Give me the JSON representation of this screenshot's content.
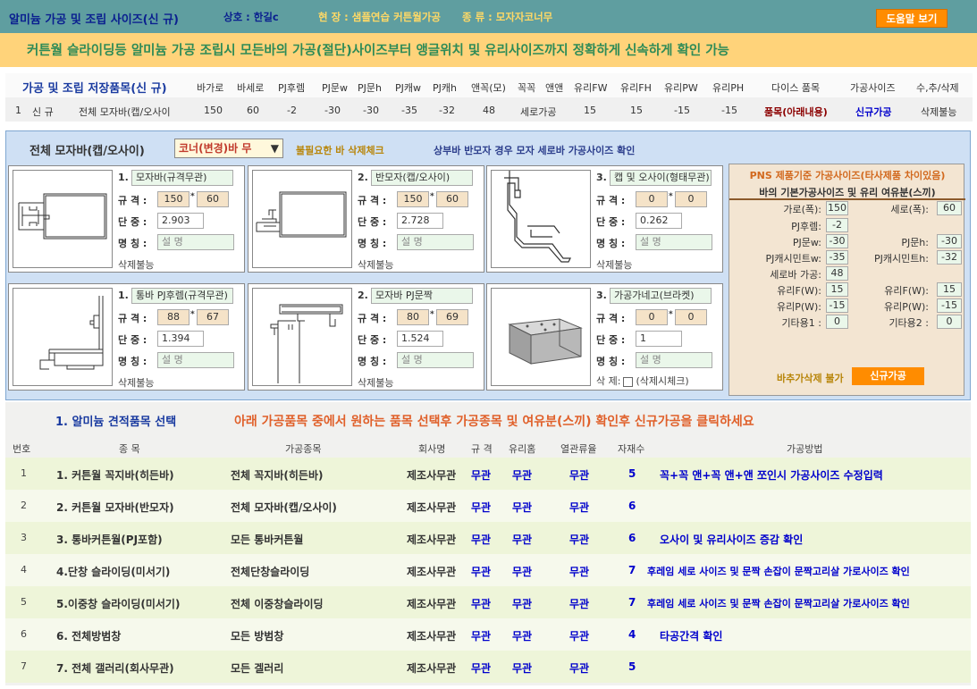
{
  "header": {
    "title": "알미늄 가공 및 조립 사이즈(신 규)",
    "company": "상호 : 한길c",
    "site": "현 장 : 샘플연습 커튼월가공",
    "kind": "종 류 : 모자자코너무",
    "help": "도움말 보기"
  },
  "banner": "커튼월 슬라이딩등 알미늄 가공 조립시 모든바의 가공(절단)사이즈부터 앵글위치 및 유리사이즈까지 정확하게 신속하게 확인 가능",
  "saved": {
    "title": "가공 및 조립 저장품목(신 규)",
    "headers": [
      "바가로",
      "바세로",
      "PJ후렘",
      "PJ문w",
      "PJ문h",
      "PJ캐w",
      "PJ캐h",
      "앤꼭(모)",
      "꼭꼭",
      "앤앤",
      "유리FW",
      "유리FH",
      "유리PW",
      "유리PH",
      "다이스 품목",
      "가공사이즈",
      "수,추/삭제"
    ],
    "row": {
      "no": "1",
      "type": "신 규",
      "name": "전체 모자바(캡/오사이",
      "vals": [
        "150",
        "60",
        "-2",
        "-30",
        "-30",
        "-35",
        "-32",
        "48",
        "세로가공",
        "15",
        "15",
        "-15",
        "-15"
      ],
      "dice": "품목(아래내용)",
      "size": "신규가공",
      "del": "삭제불능"
    }
  },
  "panel": {
    "title": "전체 모자바(캡/오사이)",
    "select": "코너(변경)바 무",
    "note1": "불필요한 바 삭제체크",
    "note2": "상부바 반모자 경우 모자 세로바 가공사이즈 확인",
    "labels": {
      "spec": "규 격 :",
      "weight": "단 중 :",
      "name": "명 칭 :",
      "x": "*",
      "desc": "설 명",
      "nodel": "삭제불능",
      "delcheck": "삭 제:",
      "delcheck2": "(삭제시체크)"
    },
    "cards": [
      {
        "n": "1.",
        "name": "모자바(규격무관)",
        "w": "150",
        "h": "60",
        "weight": "2.903"
      },
      {
        "n": "2.",
        "name": "반모자(캡/오사이)",
        "w": "150",
        "h": "60",
        "weight": "2.728"
      },
      {
        "n": "3.",
        "name": "캡 및 오사이(형태무관)",
        "w": "0",
        "h": "0",
        "weight": "0.262"
      },
      {
        "n": "1.",
        "name": "통바 PJ후렘(규격무관)",
        "w": "88",
        "h": "67",
        "weight": "1.394"
      },
      {
        "n": "2.",
        "name": "모자바 PJ문짝",
        "w": "80",
        "h": "69",
        "weight": "1.524"
      },
      {
        "n": "3.",
        "name": "가공가네고(브라켓)",
        "w": "0",
        "h": "0",
        "weight": "1"
      }
    ]
  },
  "pns": {
    "h1": "PNS 제품기준 가공사이즈(타사제품 차이있음)",
    "h2": "바의 기본가공사이즈 및 유리 여유분(스끼)",
    "left": [
      [
        "가로(폭):",
        "150"
      ],
      [
        "PJ후렘:",
        "-2"
      ],
      [
        "PJ문w:",
        "-30"
      ],
      [
        "PJ캐시민트w:",
        "-35"
      ],
      [
        "세로바 가공:",
        "48"
      ],
      [
        "유리F(W):",
        "15"
      ],
      [
        "유리P(W):",
        "-15"
      ],
      [
        "기타용1 :",
        "0"
      ]
    ],
    "right": [
      [
        "세로(폭):",
        "60"
      ],
      [
        "PJ문h:",
        "-30"
      ],
      [
        "PJ캐시민트h:",
        "-32"
      ],
      [
        "유리F(W):",
        "15"
      ],
      [
        "유리P(W):",
        "-15"
      ],
      [
        "기타용2 :",
        "0"
      ]
    ],
    "nodel": "바추가삭제 불가",
    "newbtn": "신규가공"
  },
  "selection": {
    "title": "1. 알미늄 견적품목 선택",
    "msg": "아래 가공품목 중에서 원하는 품목 선택후 가공종목 및 여유분(스끼) 확인후 신규가공을 클릭하세요",
    "headers": [
      "번호",
      "종 목",
      "가공종목",
      "회사명",
      "규 격",
      "유리홈",
      "열관류율",
      "자재수",
      "가공방법"
    ],
    "rows": [
      {
        "no": "1",
        "item": "1. 커튼월 꼭지바(히든바)",
        "proc": "전체 꼭지바(히든바)",
        "co": "제조사무관",
        "spec": "무관",
        "groove": "무관",
        "heat": "무관",
        "cnt": "5",
        "method": "꼭+꼭 앤+꼭 앤+앤 쪼인시 가공사이즈 수정입력"
      },
      {
        "no": "2",
        "item": "2. 커튼월 모자바(반모자)",
        "proc": "전체 모자바(캡/오사이)",
        "co": "제조사무관",
        "spec": "무관",
        "groove": "무관",
        "heat": "무관",
        "cnt": "6",
        "method": ""
      },
      {
        "no": "3",
        "item": "3. 통바커튼월(PJ포함)",
        "proc": "모든 통바커튼월",
        "co": "제조사무관",
        "spec": "무관",
        "groove": "무관",
        "heat": "무관",
        "cnt": "6",
        "method": "오사이 및 유리사이즈 증감 확인"
      },
      {
        "no": "4",
        "item": "4.단창 슬라이딩(미서기)",
        "proc": "전체단창슬라이딩",
        "co": "제조사무관",
        "spec": "무관",
        "groove": "무관",
        "heat": "무관",
        "cnt": "7",
        "method": "후레임 세로 사이즈 및 문짝 손잡이 문짝고리살 가로사이즈 확인"
      },
      {
        "no": "5",
        "item": "5.이중창 슬라이딩(미서기)",
        "proc": "전체 이중창슬라이딩",
        "co": "제조사무관",
        "spec": "무관",
        "groove": "무관",
        "heat": "무관",
        "cnt": "7",
        "method": "후레임 세로 사이즈 및 문짝 손잡이 문짝고리살 가로사이즈 확인"
      },
      {
        "no": "6",
        "item": "6. 전체방범창",
        "proc": "모든 방범창",
        "co": "제조사무관",
        "spec": "무관",
        "groove": "무관",
        "heat": "무관",
        "cnt": "4",
        "method": "타공간격 확인"
      },
      {
        "no": "7",
        "item": "7. 전체 갤러리(회사무관)",
        "proc": "모든 겔러리",
        "co": "제조사무관",
        "spec": "무관",
        "groove": "무관",
        "heat": "무관",
        "cnt": "5",
        "method": ""
      }
    ]
  }
}
